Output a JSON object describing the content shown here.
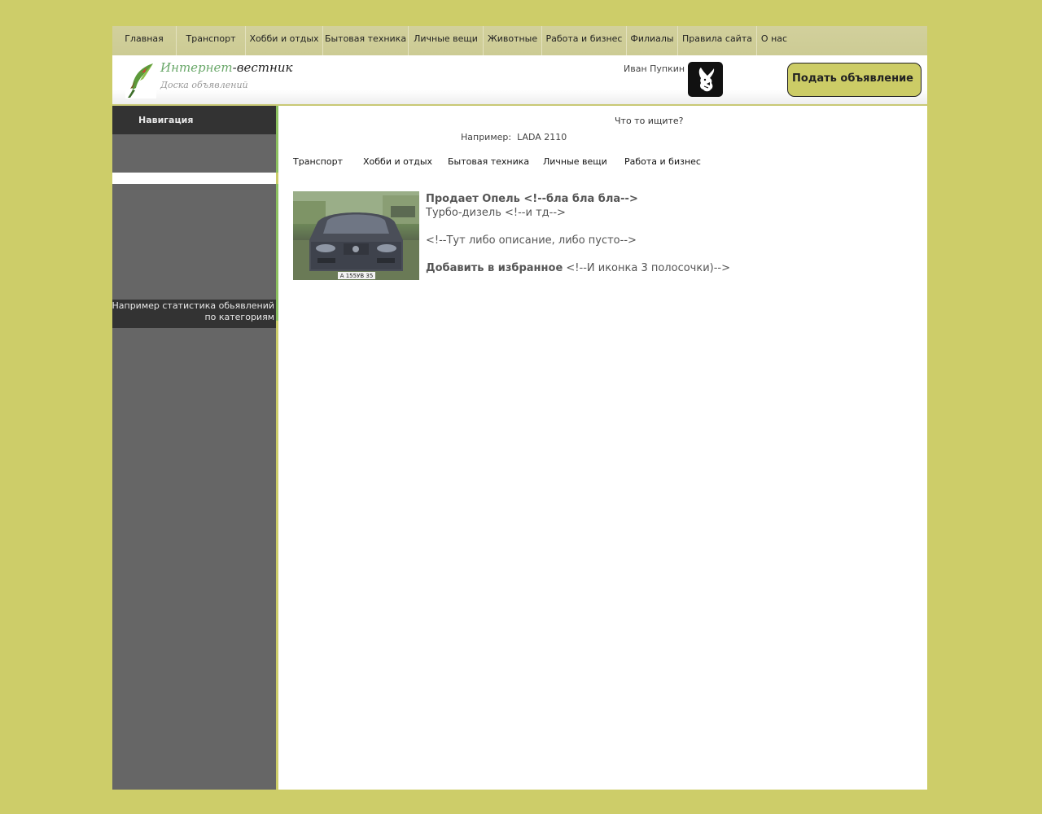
{
  "topnav": {
    "items": [
      {
        "label": "Главная"
      },
      {
        "label": "Транспорт"
      },
      {
        "label": "Хобби и отдых"
      },
      {
        "label": "Бытовая техника"
      },
      {
        "label": "Личные вещи"
      },
      {
        "label": "Животные"
      },
      {
        "label": "Работа и бизнес"
      },
      {
        "label": "Филиалы"
      },
      {
        "label": "Правила сайта"
      },
      {
        "label": "О нас"
      }
    ]
  },
  "header": {
    "logo_title_green": "Интернет",
    "logo_title_rest": "-вестник",
    "logo_subtitle": "Доска объявлений",
    "username": "Иван Пупкин",
    "avatar_icon": "playboy-bunny-icon",
    "post_ad_label": "Подать объявление",
    "accent_color": "#cccc66"
  },
  "sidebar": {
    "nav_heading": "Навигация",
    "stats_text": "Например статистика обьявлений по категориям"
  },
  "search": {
    "label": "Что то ищите?",
    "example_prefix": "Например:",
    "example_value": "LADA 2110"
  },
  "categories": [
    {
      "label": "Транспорт"
    },
    {
      "label": "Хобби и отдых"
    },
    {
      "label": "Бытовая техника"
    },
    {
      "label": "Личные вещи"
    },
    {
      "label": "Работа и бизнес"
    }
  ],
  "listing": {
    "title": "Продает Опель <!--бла бла бла-->",
    "subtitle": "Турбо-дизель <!--и тд-->",
    "description": "<!--Тут либо описание, либо пусто-->",
    "fav_label": "Добавить в избранное",
    "fav_note": "<!--И иконка 3 полосочки)-->",
    "plate": "А 155УВ 35"
  }
}
